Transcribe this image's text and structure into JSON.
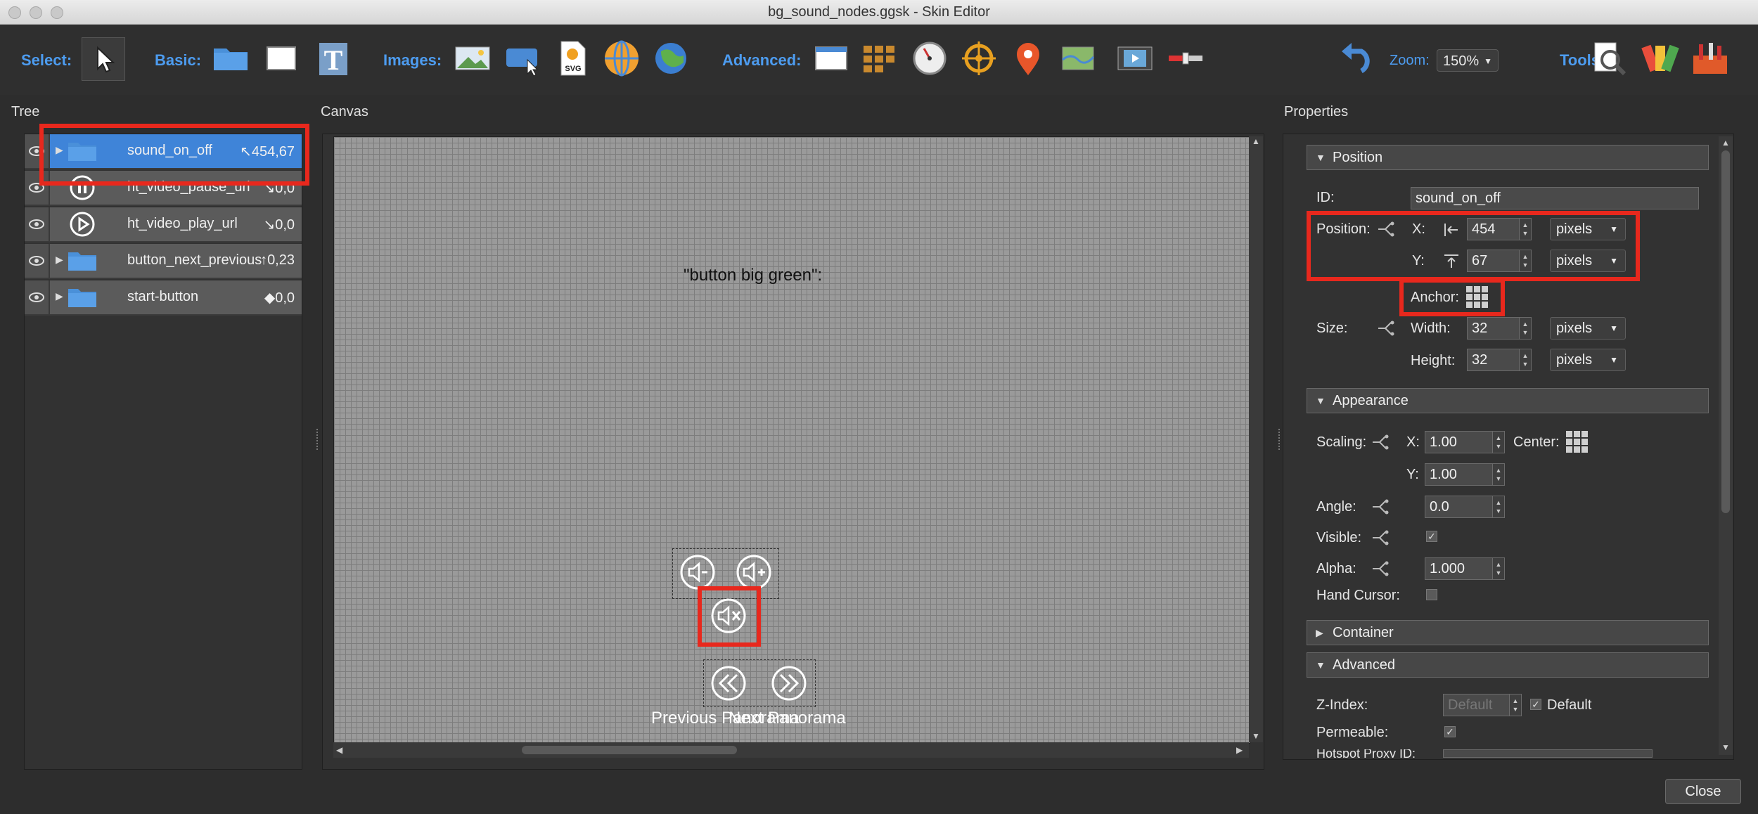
{
  "window": {
    "title": "bg_sound_nodes.ggsk - Skin Editor"
  },
  "toolbar": {
    "select_label": "Select:",
    "basic_label": "Basic:",
    "images_label": "Images:",
    "advanced_label": "Advanced:",
    "zoom_label": "Zoom:",
    "zoom_value": "150%",
    "tools_label": "Tools:",
    "svg_badge": "SVG"
  },
  "tree": {
    "title": "Tree",
    "items": [
      {
        "label": "sound_on_off",
        "pos": "↖454,67",
        "selected": true
      },
      {
        "label": "ht_video_pause_url",
        "pos": "↘0,0"
      },
      {
        "label": "ht_video_play_url",
        "pos": "↘0,0"
      },
      {
        "label": "button_next_previous",
        "pos": "↑0,23"
      },
      {
        "label": "start-button",
        "pos": "◆0,0"
      }
    ]
  },
  "canvas": {
    "title": "Canvas",
    "caption": "\"button big green\":",
    "prev_label": "Previous Panorama",
    "next_label": "Next Panorama"
  },
  "properties": {
    "title": "Properties",
    "position_section": "Position",
    "id_label": "ID:",
    "id_value": "sound_on_off",
    "position_label": "Position:",
    "x_label": "X:",
    "x_value": "454",
    "y_label": "Y:",
    "y_value": "67",
    "unit": "pixels",
    "anchor_label": "Anchor:",
    "size_label": "Size:",
    "width_label": "Width:",
    "width_value": "32",
    "height_label": "Height:",
    "height_value": "32",
    "appearance_section": "Appearance",
    "scaling_label": "Scaling:",
    "scale_x_label": "X:",
    "scale_x": "1.00",
    "scale_y_label": "Y:",
    "scale_y": "1.00",
    "center_label": "Center:",
    "angle_label": "Angle:",
    "angle_value": "0.0",
    "visible_label": "Visible:",
    "alpha_label": "Alpha:",
    "alpha_value": "1.000",
    "hand_cursor_label": "Hand Cursor:",
    "container_section": "Container",
    "advanced_section": "Advanced",
    "zindex_label": "Z-Index:",
    "zindex_placeholder": "Default",
    "zindex_default_label": "Default",
    "permeable_label": "Permeable:",
    "hotspot_label": "Hotspot Proxy ID:"
  },
  "footer": {
    "close_label": "Close"
  },
  "colors": {
    "accent": "#4d9cf0",
    "selection": "#3f84d8",
    "highlight": "#e8281d"
  }
}
